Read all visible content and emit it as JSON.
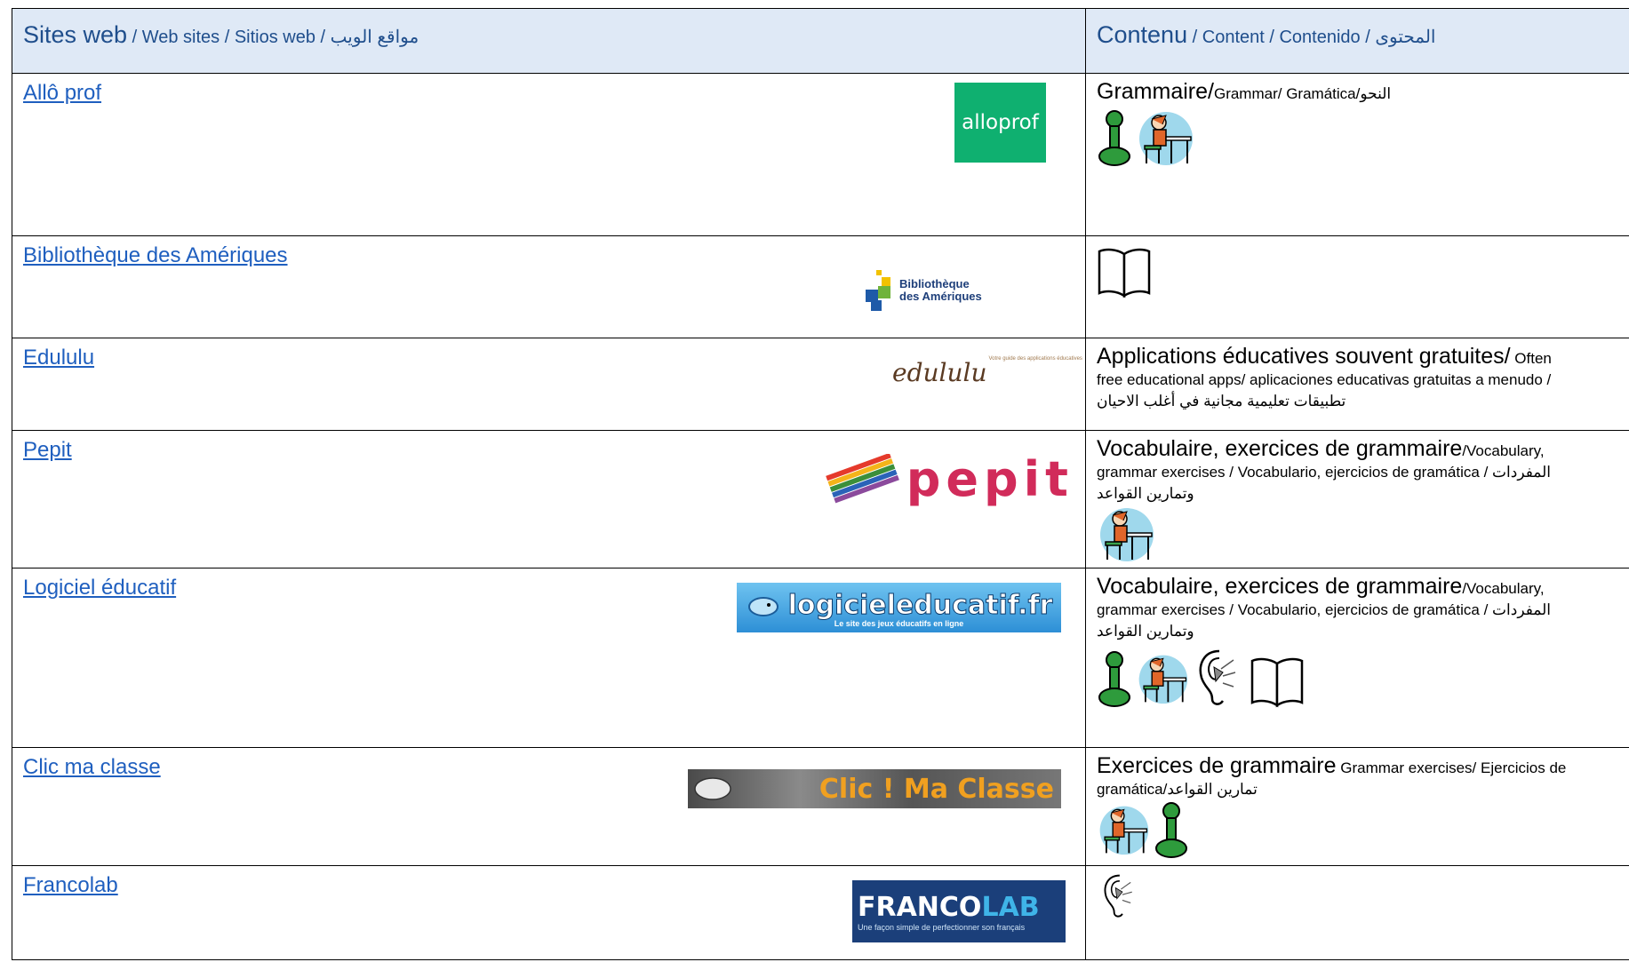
{
  "header": {
    "col1_big": "Sites web",
    "col1_rest": " / Web sites / Sitios web / مواقع الويب",
    "col2_big": "Contenu",
    "col2_rest": " / Content / Contenido / المحتوى"
  },
  "rows": [
    {
      "link": "Allô prof",
      "logo_text": "alloprof",
      "content_big": "Grammaire/",
      "content_small": "Grammar/ Gramática/النحو",
      "content_line2": "",
      "content_line3": "",
      "icons": [
        "game-piece-icon",
        "student-desk-icon"
      ]
    },
    {
      "link": "Bibliothèque des Amériques",
      "logo_text_1": "Bibliothèque",
      "logo_text_2": "des Amériques",
      "icons": [
        "book-icon"
      ]
    },
    {
      "link": "Edululu",
      "logo_text": "edululu",
      "logo_tagline": "Votre guide des applications éducatives",
      "content_big": "Applications éducatives souvent gratuites/",
      "content_small": " Often",
      "content_line2": "free educational apps/ aplicaciones educativas gratuitas a menudo /",
      "content_line3": "تطبيقات تعليمية مجانية في أغلب الاحيان",
      "icons": []
    },
    {
      "link": "Pepit",
      "logo_text": "pepit",
      "content_big": "Vocabulaire, exercices de grammaire",
      "content_small": "/Vocabulary,",
      "content_line2": "grammar exercises / Vocabulario, ejercicios de gramática /  المفردات",
      "content_line3": "وتمارين القواعد",
      "icons": [
        "student-desk-icon"
      ]
    },
    {
      "link": "Logiciel éducatif",
      "logo_text": "logicieleducatif.fr",
      "logo_tagline": "Le site des jeux éducatifs en ligne",
      "content_big": "Vocabulaire, exercices de grammaire",
      "content_small": "/Vocabulary,",
      "content_line2": "grammar exercises / Vocabulario, ejercicios de gramática /  المفردات",
      "content_line3": "وتمارين القواعد",
      "icons": [
        "game-piece-icon",
        "student-desk-icon",
        "ear-icon",
        "book-icon"
      ]
    },
    {
      "link": "Clic ma classe",
      "logo_text": "Clic ! Ma Classe",
      "content_big": "Exercices de grammaire",
      "content_small": " Grammar exercises/ Ejercicios de",
      "content_line2": "gramática/تمارين القواعد",
      "content_line3": "",
      "icons": [
        "student-desk-icon",
        "game-piece-icon"
      ]
    },
    {
      "link": "Francolab",
      "logo_text_1": "FRANCO",
      "logo_text_2": "LAB",
      "logo_tagline": "Une façon simple de perfectionner son français",
      "icons": [
        "ear-icon"
      ]
    }
  ]
}
